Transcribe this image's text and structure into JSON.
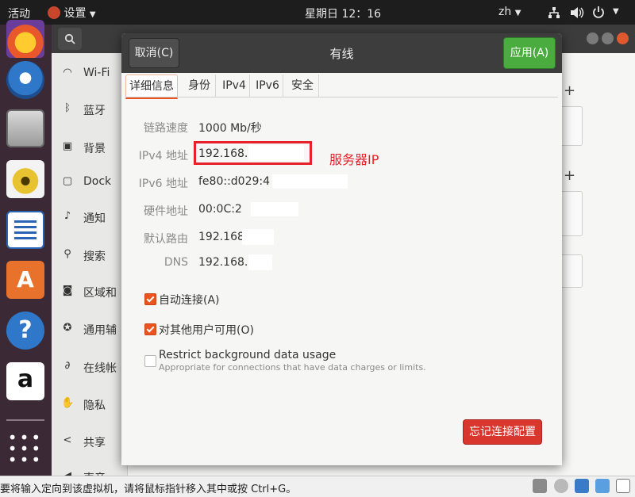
{
  "topbar": {
    "activities": "活动",
    "app_menu": "设置",
    "clock": "星期日 12：16",
    "input_method": "zh"
  },
  "dock": {
    "apps": [
      "firefox-icon",
      "thunderbird-icon",
      "files-icon",
      "rhythmbox-icon",
      "libreoffice-writer-icon",
      "ubuntu-software-icon",
      "help-icon",
      "amazon-icon",
      "show-applications-icon"
    ]
  },
  "sidebar": {
    "items": [
      {
        "label": "Wi-Fi"
      },
      {
        "label": "蓝牙"
      },
      {
        "label": "背景"
      },
      {
        "label": "Dock"
      },
      {
        "label": "通知"
      },
      {
        "label": "搜索"
      },
      {
        "label": "区域和"
      },
      {
        "label": "通用辅"
      },
      {
        "label": "在线帐"
      },
      {
        "label": "隐私"
      },
      {
        "label": "共享"
      },
      {
        "label": "声音"
      }
    ]
  },
  "dialog": {
    "title": "有线",
    "cancel_label": "取消(C)",
    "apply_label": "应用(A)",
    "tabs": [
      "详细信息",
      "身份",
      "IPv4",
      "IPv6",
      "安全"
    ],
    "details": {
      "link_speed_label": "链路速度",
      "link_speed_value": "1000 Mb/秒",
      "ipv4_label": "IPv4 地址",
      "ipv4_value": "192.168.",
      "ipv6_label": "IPv6 地址",
      "ipv6_value": "fe80::d029:4",
      "hw_label": "硬件地址",
      "hw_value": "00:0C:2",
      "gateway_label": "默认路由",
      "gateway_value": "192.168",
      "dns_label": "DNS",
      "dns_value": "192.168.1"
    },
    "annotation": "服务器IP",
    "auto_connect_label": "自动连接(A)",
    "auto_connect_checked": true,
    "all_users_label": "对其他用户可用(O)",
    "all_users_checked": true,
    "restrict_label": "Restrict background data usage",
    "restrict_sub": "Appropriate for connections that have data charges or limits.",
    "restrict_checked": false,
    "forget_label": "忘记连接配置"
  },
  "statusbar": {
    "message": "要将输入定向到该虚拟机，请将鼠标指针移入其中或按 Ctrl+G。"
  },
  "colors": {
    "accent": "#e95420",
    "apply_green": "#4aac3e",
    "forget_red": "#d9362d",
    "annotation_red": "#e8202a"
  }
}
